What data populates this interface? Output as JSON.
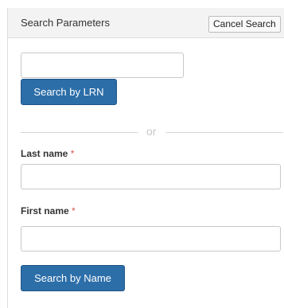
{
  "header": {
    "title": "Search Parameters",
    "cancel_label": "Cancel Search"
  },
  "lrn": {
    "value": "",
    "placeholder": "",
    "button_label": "Search by LRN"
  },
  "divider": {
    "text": "or"
  },
  "last_name": {
    "label": "Last name",
    "required_mark": "*",
    "value": ""
  },
  "first_name": {
    "label": "First name",
    "required_mark": "*",
    "value": ""
  },
  "name_search": {
    "button_label": "Search by Name"
  },
  "colors": {
    "primary_button": "#2c6ea8",
    "required_mark": "#d9534f"
  }
}
